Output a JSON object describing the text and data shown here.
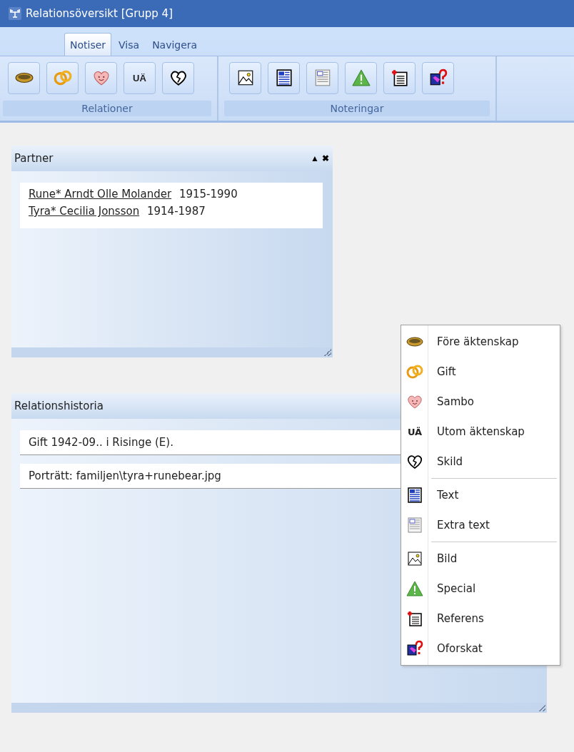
{
  "window": {
    "title": "Relationsöversikt [Grupp 4]"
  },
  "tabs": [
    {
      "label": "Notiser",
      "selected": true
    },
    {
      "label": "Visa",
      "selected": false
    },
    {
      "label": "Navigera",
      "selected": false
    }
  ],
  "ribbon_groups": [
    {
      "label": "Relationer",
      "buttons": [
        {
          "kind": "ring"
        },
        {
          "kind": "rings"
        },
        {
          "kind": "heart"
        },
        {
          "kind": "letters",
          "text": "UÄ"
        },
        {
          "kind": "broken-heart"
        }
      ]
    },
    {
      "label": "Noteringar",
      "buttons": [
        {
          "kind": "image"
        },
        {
          "kind": "text"
        },
        {
          "kind": "extra-text"
        },
        {
          "kind": "warning"
        },
        {
          "kind": "reference"
        },
        {
          "kind": "unknown"
        }
      ]
    }
  ],
  "partner_panel": {
    "title": "Partner",
    "controls": [
      "▲",
      "✖"
    ],
    "people": [
      {
        "name": "Rune* Arndt Olle Molander",
        "years": "1915-1990"
      },
      {
        "name": "Tyra* Cecilia Jonsson",
        "years": "1914-1987"
      }
    ]
  },
  "history_panel": {
    "title": "Relationshistoria",
    "entries": [
      "Gift 1942-09.. i Risinge (E).",
      "Porträtt: familjen\\tyra+runebear.jpg"
    ]
  },
  "context_menu": {
    "sections": [
      [
        {
          "label": "Före äktenskap",
          "kind": "ring"
        },
        {
          "label": "Gift",
          "kind": "rings"
        },
        {
          "label": "Sambo",
          "kind": "heart"
        },
        {
          "label": "Utom äktenskap",
          "kind": "letters",
          "text": "UÄ"
        },
        {
          "label": "Skild",
          "kind": "broken-heart"
        }
      ],
      [
        {
          "label": "Text",
          "kind": "text"
        },
        {
          "label": "Extra text",
          "kind": "extra-text"
        }
      ],
      [
        {
          "label": "Bild",
          "kind": "image"
        },
        {
          "label": "Special",
          "kind": "warning"
        },
        {
          "label": "Referens",
          "kind": "reference"
        },
        {
          "label": "Oforskat",
          "kind": "unknown"
        }
      ]
    ]
  }
}
